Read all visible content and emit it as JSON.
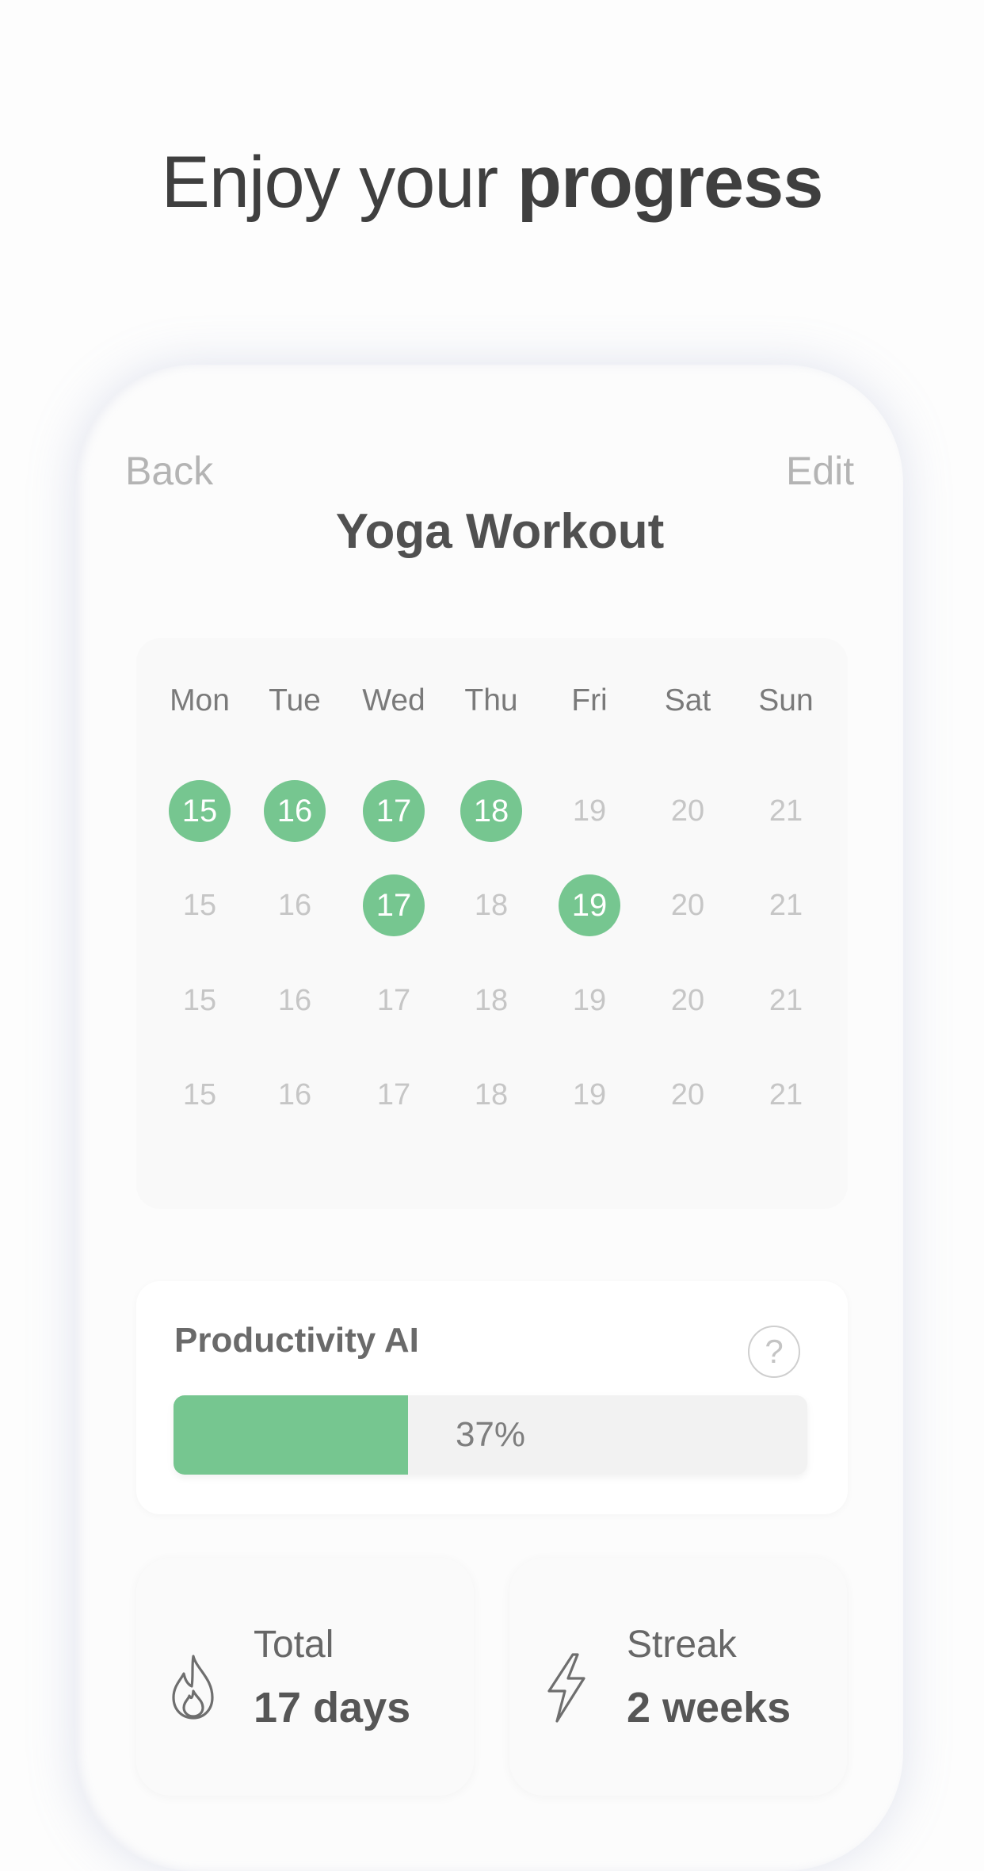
{
  "headline": {
    "light": "Enjoy your ",
    "bold": "progress"
  },
  "nav": {
    "back_label": "Back",
    "edit_label": "Edit"
  },
  "screen": {
    "title": "Yoga Workout"
  },
  "calendar": {
    "day_names": [
      "Mon",
      "Tue",
      "Wed",
      "Thu",
      "Fri",
      "Sat",
      "Sun"
    ],
    "weeks": [
      [
        {
          "day": "15",
          "done": true
        },
        {
          "day": "16",
          "done": true
        },
        {
          "day": "17",
          "done": true
        },
        {
          "day": "18",
          "done": true
        },
        {
          "day": "19",
          "done": false
        },
        {
          "day": "20",
          "done": false
        },
        {
          "day": "21",
          "done": false
        }
      ],
      [
        {
          "day": "15",
          "done": false
        },
        {
          "day": "16",
          "done": false
        },
        {
          "day": "17",
          "done": true
        },
        {
          "day": "18",
          "done": false
        },
        {
          "day": "19",
          "done": true
        },
        {
          "day": "20",
          "done": false
        },
        {
          "day": "21",
          "done": false
        }
      ],
      [
        {
          "day": "15",
          "done": false
        },
        {
          "day": "16",
          "done": false
        },
        {
          "day": "17",
          "done": false
        },
        {
          "day": "18",
          "done": false
        },
        {
          "day": "19",
          "done": false
        },
        {
          "day": "20",
          "done": false
        },
        {
          "day": "21",
          "done": false
        }
      ],
      [
        {
          "day": "15",
          "done": false
        },
        {
          "day": "16",
          "done": false
        },
        {
          "day": "17",
          "done": false
        },
        {
          "day": "18",
          "done": false
        },
        {
          "day": "19",
          "done": false
        },
        {
          "day": "20",
          "done": false
        },
        {
          "day": "21",
          "done": false
        }
      ]
    ],
    "done_color": "#76c690"
  },
  "productivity": {
    "title": "Productivity AI",
    "help_icon": "question-circle-icon",
    "help_glyph": "?",
    "percent": 37,
    "percent_label": "37%",
    "fill_color": "#76c690"
  },
  "stats": {
    "total": {
      "icon": "flame-icon",
      "label": "Total",
      "value": "17 days"
    },
    "streak": {
      "icon": "lightning-icon",
      "label": "Streak",
      "value": "2 weeks"
    }
  }
}
